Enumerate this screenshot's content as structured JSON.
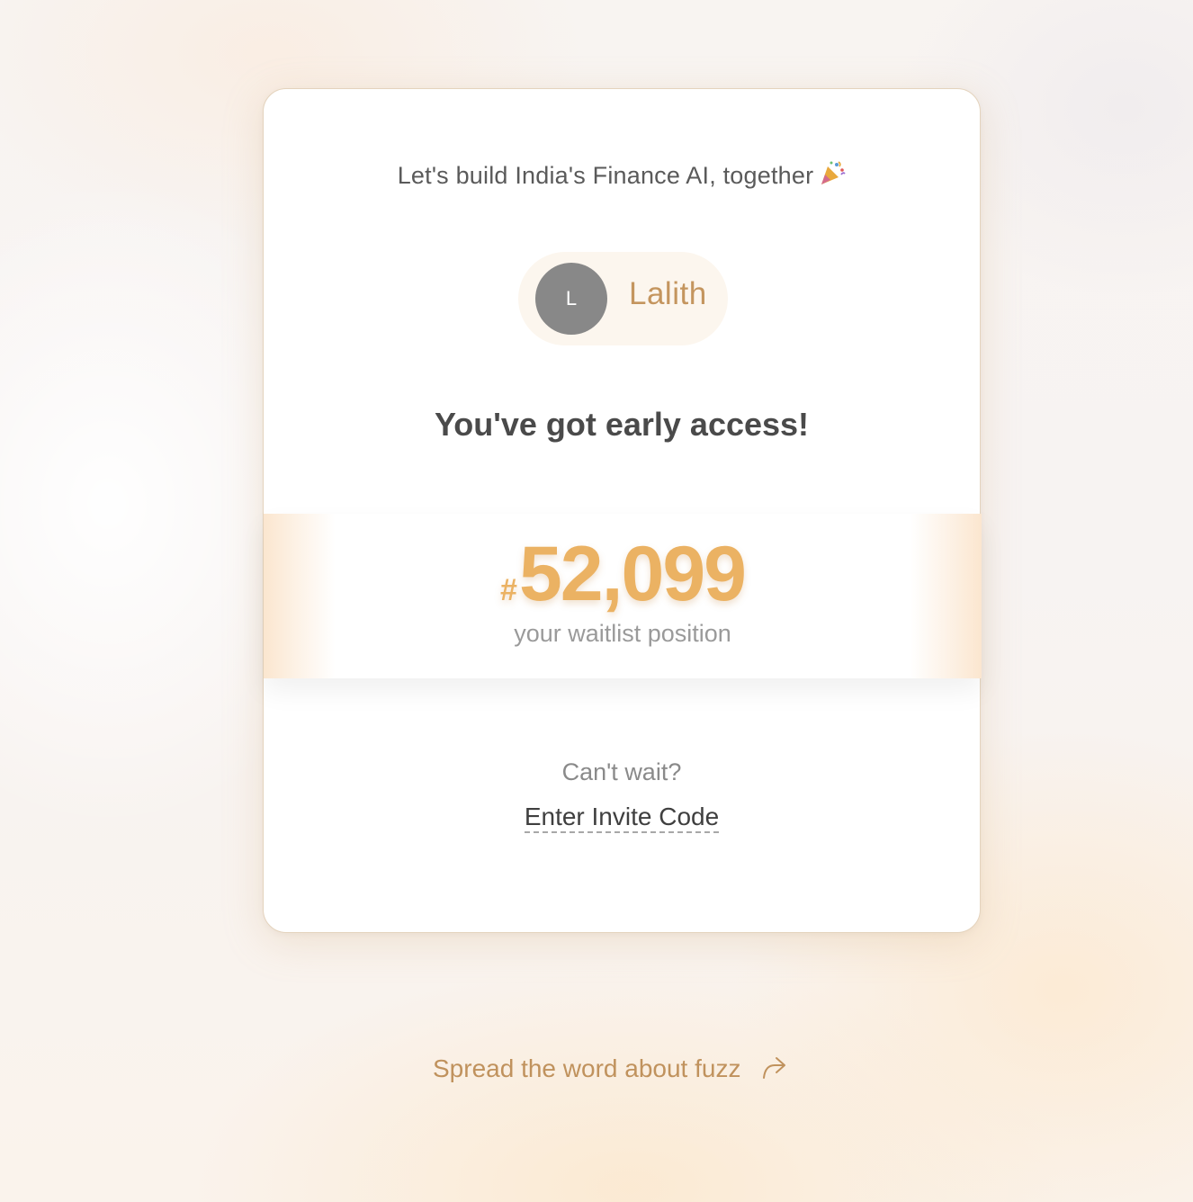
{
  "card": {
    "headline": "Let's build India's Finance AI, together",
    "headline_emoji": "party-popper-icon",
    "user": {
      "avatar_initial": "L",
      "name": "Lalith"
    },
    "access_title": "You've got early access!",
    "waitlist": {
      "hash": "#",
      "position": "52,099",
      "caption": "your waitlist position"
    },
    "cant_wait": "Can't wait?",
    "invite_link": "Enter Invite Code"
  },
  "footer": {
    "spread_label": "Spread the word about fuzz",
    "share_icon": "share-arrow-icon"
  },
  "colors": {
    "accent": "#ebb263",
    "brand_text": "#c0925d",
    "avatar_bg": "#888888"
  }
}
